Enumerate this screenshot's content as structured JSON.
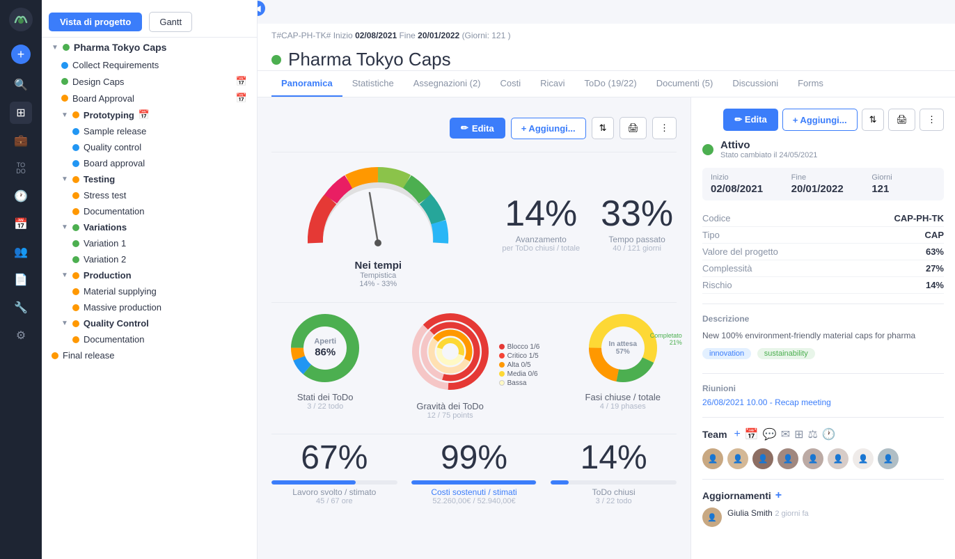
{
  "nav": {
    "logo": "🌿",
    "items": [
      {
        "id": "add",
        "icon": "+",
        "label": "add"
      },
      {
        "id": "search",
        "icon": "🔍",
        "label": "search"
      },
      {
        "id": "dashboard",
        "icon": "⊞",
        "label": "dashboard"
      },
      {
        "id": "tasks",
        "icon": "📋",
        "label": "tasks"
      },
      {
        "id": "todo",
        "label": "TO\nDO"
      },
      {
        "id": "clock",
        "icon": "🕐",
        "label": "clock"
      },
      {
        "id": "calendar",
        "icon": "📅",
        "label": "calendar"
      },
      {
        "id": "team",
        "icon": "👥",
        "label": "team"
      },
      {
        "id": "reports",
        "icon": "📄",
        "label": "reports"
      },
      {
        "id": "tools",
        "icon": "🔧",
        "label": "tools"
      },
      {
        "id": "settings",
        "icon": "⚙",
        "label": "settings"
      }
    ]
  },
  "topbar": {
    "btn_project": "Vista di progetto",
    "btn_gantt": "Gantt"
  },
  "sidebar": {
    "project_name": "Pharma Tokyo Caps",
    "items": [
      {
        "label": "Collect Requirements",
        "dot": "blue",
        "indent": 1
      },
      {
        "label": "Design Caps",
        "dot": "green",
        "indent": 1,
        "calendar": true
      },
      {
        "label": "Board Approval",
        "dot": "orange",
        "indent": 1,
        "calendar": true
      },
      {
        "label": "Prototyping",
        "dot": "orange",
        "indent": 0,
        "group": true,
        "calendar": true
      },
      {
        "label": "Sample release",
        "dot": "blue",
        "indent": 2
      },
      {
        "label": "Quality control",
        "dot": "blue",
        "indent": 2
      },
      {
        "label": "Board approval",
        "dot": "blue",
        "indent": 2
      },
      {
        "label": "Testing",
        "dot": "orange",
        "indent": 0,
        "group": true
      },
      {
        "label": "Stress test",
        "dot": "orange",
        "indent": 2
      },
      {
        "label": "Documentation",
        "dot": "orange",
        "indent": 2
      },
      {
        "label": "Variations",
        "dot": "green",
        "indent": 0,
        "group": true
      },
      {
        "label": "Variation 1",
        "dot": "green",
        "indent": 2
      },
      {
        "label": "Variation 2",
        "dot": "green",
        "indent": 2
      },
      {
        "label": "Production",
        "dot": "orange",
        "indent": 0,
        "group": true
      },
      {
        "label": "Material supplying",
        "dot": "orange",
        "indent": 2
      },
      {
        "label": "Massive production",
        "dot": "orange",
        "indent": 2
      },
      {
        "label": "Quality Control",
        "dot": "orange",
        "indent": 0,
        "group": true
      },
      {
        "label": "Documentation",
        "dot": "orange",
        "indent": 2
      },
      {
        "label": "Final release",
        "dot": "orange",
        "indent": 0
      }
    ]
  },
  "project": {
    "meta": "T#CAP-PH-TK#",
    "start_label": "Inizio",
    "start": "02/08/2021",
    "end_label": "Fine",
    "end": "20/01/2022",
    "days_label": "(Giorni:",
    "days": "121 )",
    "title": "Pharma Tokyo Caps"
  },
  "tabs": [
    {
      "label": "Panoramica",
      "active": true
    },
    {
      "label": "Statistiche"
    },
    {
      "label": "Assegnazioni (2)"
    },
    {
      "label": "Costi"
    },
    {
      "label": "Ricavi"
    },
    {
      "label": "ToDo (19/22)"
    },
    {
      "label": "Documenti (5)"
    },
    {
      "label": "Discussioni"
    },
    {
      "label": "Forms"
    }
  ],
  "actions": {
    "edit": "Edita",
    "add": "+ Aggiungi..."
  },
  "gauge": {
    "label": "Nei tempi",
    "sublabel": "Tempistica",
    "range": "14% - 33%"
  },
  "stat_progress": {
    "value": "14%",
    "label": "Avanzamento",
    "sublabel": "per ToDo chiusi / totale"
  },
  "stat_time": {
    "value": "33%",
    "label": "Tempo passato",
    "sublabel": "40 / 121 giorni"
  },
  "donuts": [
    {
      "id": "stati",
      "center_label": "Aperti",
      "center_value": "86%",
      "label": "Stati dei ToDo",
      "sublabel": "3 / 22 todo",
      "segments": [
        {
          "color": "#4caf50",
          "pct": 86
        },
        {
          "color": "#2196f3",
          "pct": 8
        },
        {
          "color": "#ff9800",
          "pct": 6
        }
      ]
    },
    {
      "id": "gravita",
      "label": "Gravità dei ToDo",
      "sublabel": "12 / 75 points",
      "legend": [
        {
          "color": "#e53935",
          "label": "Blocco 1/6"
        },
        {
          "color": "#f44336",
          "label": "Critico 1/5"
        },
        {
          "color": "#ff9800",
          "label": "Alta 0/5"
        },
        {
          "color": "#fdd835",
          "label": "Media 0/6"
        },
        {
          "color": "#fff9c4",
          "label": "Bassa"
        }
      ]
    },
    {
      "id": "fasi",
      "label": "Fasi chiuse / totale",
      "sublabel": "4 / 19 phases",
      "segments": [
        {
          "color": "#fdd835",
          "label": "In attesa",
          "pct": 57
        },
        {
          "color": "#4caf50",
          "label": "Completato",
          "pct": 21
        },
        {
          "color": "#ff9800",
          "label": "",
          "pct": 22
        }
      ]
    }
  ],
  "bottom_stats": [
    {
      "value": "67%",
      "bar_fill": 67,
      "bar_color": "#3b7dfa",
      "label": "Lavoro svolto / stimato",
      "sub": "45 / 67 ore",
      "is_link": false
    },
    {
      "value": "99%",
      "bar_fill": 99,
      "bar_color": "#3b7dfa",
      "label": "Costi sostenuti / stimati",
      "sub": "52.260,00€ / 52.940,00€",
      "is_link": true
    },
    {
      "value": "14%",
      "bar_fill": 14,
      "bar_color": "#3b7dfa",
      "label": "ToDo chiusi",
      "sub": "3 / 22 todo",
      "is_link": false
    }
  ],
  "right_panel": {
    "status": "Attivo",
    "status_changed": "Stato cambiato il 24/05/2021",
    "dates": {
      "start_label": "Inizio",
      "start": "02/08/2021",
      "end_label": "Fine",
      "end": "20/01/2022",
      "days_label": "Giorni",
      "days": "121"
    },
    "props": [
      {
        "label": "Codice",
        "value": "CAP-PH-TK"
      },
      {
        "label": "Tipo",
        "value": "CAP"
      },
      {
        "label": "Valore del progetto",
        "value": "63%"
      },
      {
        "label": "Complessità",
        "value": "27%"
      },
      {
        "label": "Rischio",
        "value": "14%"
      }
    ],
    "description_label": "Descrizione",
    "description": "New 100% environment-friendly material caps for pharma",
    "tags": [
      "innovation",
      "sustainability"
    ],
    "meetings_label": "Riunioni",
    "meeting": "26/08/2021 10.00 - Recap meeting",
    "team_label": "Team",
    "updates_label": "Aggiornamenti",
    "update_author": "Giulia Smith",
    "update_time": "2 giorni fa"
  }
}
